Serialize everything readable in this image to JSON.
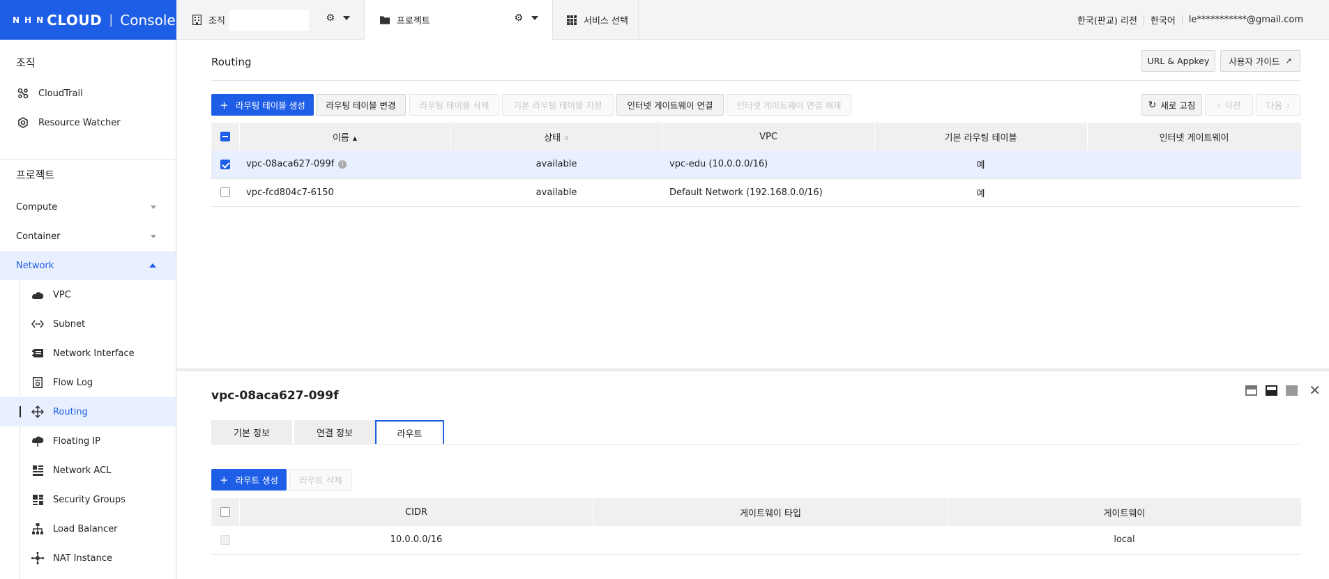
{
  "brand": {
    "nhn": "NHN",
    "cloud": "CLOUD",
    "sep": "|",
    "console": "Console"
  },
  "topbar": {
    "org_label": "조직",
    "project_label": "프로젝트",
    "service_label": "서비스 선택",
    "region": "한국(판교) 리전",
    "language": "한국어",
    "account": "le***********@gmail.com"
  },
  "sidebar": {
    "org_title": "조직",
    "org_items": [
      "CloudTrail",
      "Resource Watcher"
    ],
    "project_title": "프로젝트",
    "categories": [
      "Compute",
      "Container",
      "Network"
    ],
    "network_items": [
      "VPC",
      "Subnet",
      "Network Interface",
      "Flow Log",
      "Routing",
      "Floating IP",
      "Network ACL",
      "Security Groups",
      "Load Balancer",
      "NAT Instance"
    ]
  },
  "main": {
    "title": "Routing",
    "url_appkey": "URL & Appkey",
    "user_guide": "사용자 가이드",
    "toolbar": {
      "create": "라우팅 테이블 생성",
      "change": "라우팅 테이블 변경",
      "delete": "라우팅 테이블 삭제",
      "set_default": "기본 라우팅 테이블 지정",
      "attach_igw": "인터넷 게이트웨이 연결",
      "detach_igw": "인터넷 게이트웨이 연결 해제",
      "refresh": "새로 고침",
      "prev": "이전",
      "next": "다음"
    },
    "table": {
      "headers": [
        "이름",
        "상태",
        "VPC",
        "기본 라우팅 테이블",
        "인터넷 게이트웨이"
      ],
      "rows": [
        {
          "name": "vpc-08aca627-099f",
          "status": "available",
          "vpc": "vpc-edu (10.0.0.0/16)",
          "default": "예",
          "igw": ""
        },
        {
          "name": "vpc-fcd804c7-6150",
          "status": "available",
          "vpc": "Default Network (192.168.0.0/16)",
          "default": "예",
          "igw": ""
        }
      ]
    }
  },
  "detail": {
    "title": "vpc-08aca627-099f",
    "tabs": [
      "기본 정보",
      "연결 정보",
      "라우트"
    ],
    "create_route": "라우트 생성",
    "delete_route": "라우트 삭제",
    "route_headers": [
      "CIDR",
      "게이트웨이 타입",
      "게이트웨이"
    ],
    "routes": [
      {
        "cidr": "10.0.0.0/16",
        "gateway_type": "",
        "gateway": "local"
      }
    ]
  },
  "colors": {
    "accent": "#1e5ee6",
    "selected_row": "#e8efff",
    "header_bg": "#f0f0f0"
  }
}
